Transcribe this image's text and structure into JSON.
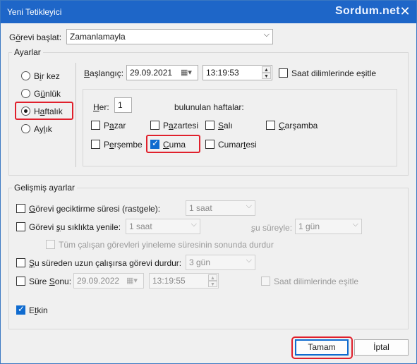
{
  "window": {
    "title": "Yeni Tetikleyici",
    "watermark": "Sordum.net",
    "close_glyph": "✕"
  },
  "begin_task": {
    "label_pre": "G",
    "label_u": "ö",
    "label_post": "revi başlat:",
    "value": "Zamanlamayla"
  },
  "settings": {
    "title": "Ayarlar",
    "radios": [
      {
        "pre": "B",
        "u": "i",
        "post": "r kez",
        "selected": false
      },
      {
        "pre": "G",
        "u": "ü",
        "post": "nlük",
        "selected": false
      },
      {
        "pre": "H",
        "u": "a",
        "post": "ftalık",
        "selected": true
      },
      {
        "pre": "Ay",
        "u": "l",
        "post": "ık",
        "selected": false
      }
    ],
    "start": {
      "label_pre": "",
      "label_u": "B",
      "label_post": "aşlangıç:",
      "date": "29.09.2021",
      "time": "13:19:53",
      "sync_label": "Saat dilimlerinde eşitle"
    },
    "recur": {
      "label_pre": "",
      "label_u": "H",
      "label_post": "er:",
      "value": "1",
      "suffix": "bulunulan haftalar:"
    },
    "days": [
      {
        "pre": "P",
        "u": "a",
        "post": "zar",
        "checked": false
      },
      {
        "pre": "P",
        "u": "a",
        "post": "zartesi",
        "checked": false
      },
      {
        "pre": "",
        "u": "S",
        "post": "alı",
        "checked": false
      },
      {
        "pre": "",
        "u": "Ç",
        "post": "arşamba",
        "checked": false
      },
      {
        "pre": "P",
        "u": "e",
        "post": "rşembe",
        "checked": false
      },
      {
        "pre": "",
        "u": "C",
        "post": "uma",
        "checked": true
      },
      {
        "pre": "Cumar",
        "u": "t",
        "post": "esi",
        "checked": false
      }
    ]
  },
  "advanced": {
    "title": "Gelişmiş ayarlar",
    "delay": {
      "label_pre": "",
      "label_u": "G",
      "label_post": "örevi geciktirme süresi (rastgele):",
      "value": "1 saat"
    },
    "repeat": {
      "label_pre": "Görevi ",
      "label_u": "ş",
      "label_post": "u sıklıkta yenile:",
      "value": "1 saat",
      "for_pre": "",
      "for_u": "ş",
      "for_post": "u süreyle:",
      "for_value": "1 gün"
    },
    "stop_all": "Tüm çalışan görevleri yineleme süresinin sonunda durdur",
    "stop_longer": {
      "label_pre": "",
      "label_u": "Ş",
      "label_post": "u süreden uzun çalışırsa görevi durdur:",
      "value": "3 gün"
    },
    "expire": {
      "label_pre": "Süre ",
      "label_u": "S",
      "label_post": "onu:",
      "date": "29.09.2022",
      "time": "13:19:55",
      "sync_label": "Saat dilimlerinde eşitle"
    },
    "enabled": {
      "label_pre": "E",
      "label_u": "t",
      "label_post": "kin",
      "checked": true
    }
  },
  "buttons": {
    "ok": "Tamam",
    "cancel": "İptal"
  },
  "colors": {
    "titlebar": "#1e66c8",
    "highlight": "#e0202c",
    "accent": "#0f6bcf"
  }
}
